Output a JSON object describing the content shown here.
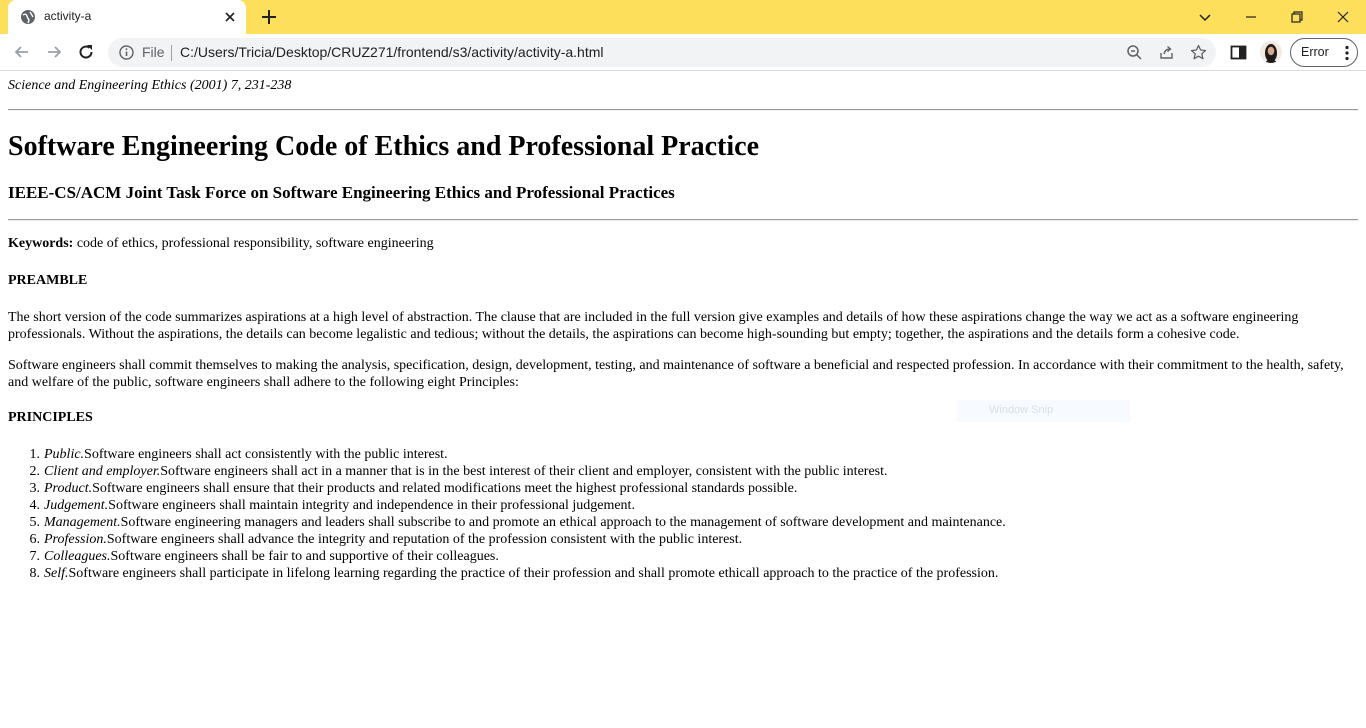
{
  "browser": {
    "tab_title": "activity-a",
    "scheme_label": "File",
    "url": "C:/Users/Tricia/Desktop/CRUZ271/frontend/s3/activity/activity-a.html",
    "profile_status": "Error",
    "colors": {
      "tabstrip": "#fddf5c",
      "omnibox": "#f1f3f4"
    }
  },
  "document": {
    "citation": "Science and Engineering Ethics (2001) 7, 231-238",
    "title": "Software Engineering Code of Ethics and Professional Practice",
    "subtitle": "IEEE-CS/ACM Joint Task Force on Software Engineering Ethics and Professional Practices",
    "keywords_label": "Keywords:",
    "keywords": "code of ethics, professional responsibility, software engineering",
    "preamble_heading": "PREAMBLE",
    "preamble_p1": "The short version of the code summarizes aspirations at a high level of abstraction. The clause that are included in the full version give examples and details of how these aspirations change the way we act as a software engineering professionals. Without the aspirations, the details can become legalistic and tedious; without the details, the aspirations can become high-sounding but empty; together, the aspirations and the details form a cohesive code.",
    "preamble_p2": "Software engineers shall commit themselves to making the analysis, specification, design, development, testing, and maintenance of software a beneficial and respected profession. In accordance with their commitment to the health, safety, and welfare of the public, software engineers shall adhere to the following eight Principles:",
    "principles_heading": "PRINCIPLES",
    "principles": [
      {
        "num": "1.",
        "name": "Public.",
        "text": "Software engineers shall act consistently with the public interest."
      },
      {
        "num": "2.",
        "name": "Client and employer.",
        "text": "Software engineers shall act in a manner that is in the best interest of their client and employer, consistent with the public interest."
      },
      {
        "num": "3.",
        "name": "Product.",
        "text": "Software engineers shall ensure that their products and related modifications meet the highest professional standards possible."
      },
      {
        "num": "4.",
        "name": "Judgement.",
        "text": "Software engineers shall maintain integrity and independence in their professional judgement."
      },
      {
        "num": "5.",
        "name": "Management.",
        "text": "Software engineering managers and leaders shall subscribe to and promote an ethical approach to the management of software development and maintenance."
      },
      {
        "num": "6.",
        "name": "Profession.",
        "text": "Software engineers shall advance the integrity and reputation of the profession consistent with the public interest."
      },
      {
        "num": "7.",
        "name": "Colleagues.",
        "text": "Software engineers shall be fair to and supportive of their colleagues."
      },
      {
        "num": "8.",
        "name": "Self.",
        "text": "Software engineers shall participate in lifelong learning regarding the practice of their profession and shall promote ethicall approach to the practice of the profession."
      }
    ]
  },
  "overlay": {
    "snip_label": "Window Snip"
  }
}
